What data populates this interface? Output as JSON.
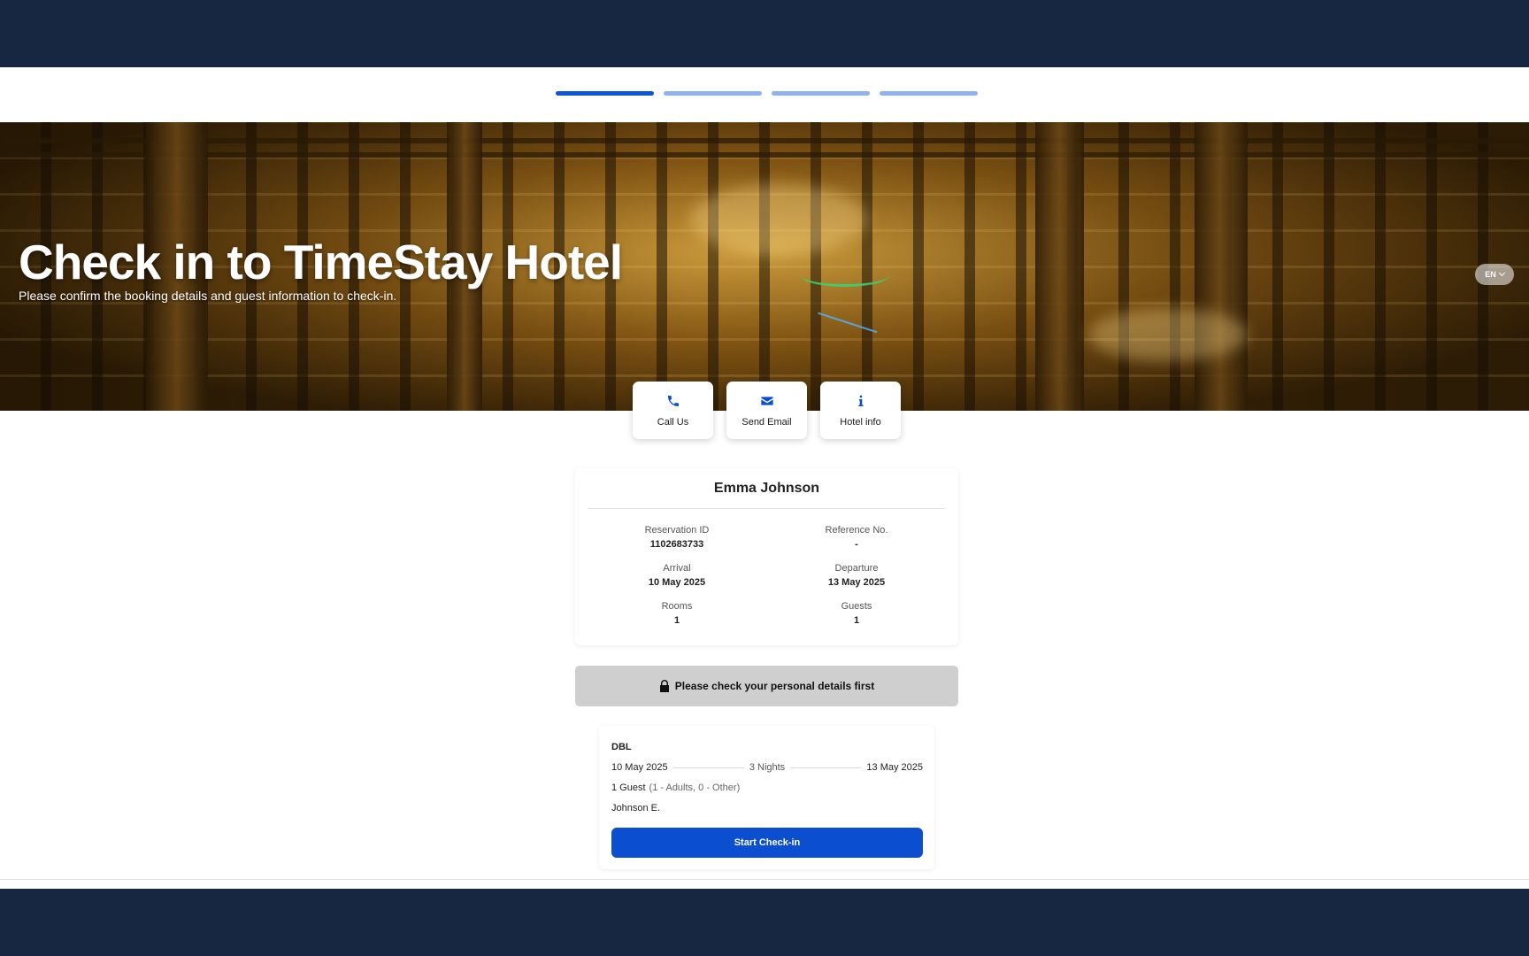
{
  "progress": {
    "steps": 4,
    "current": 1
  },
  "hero": {
    "title": "Check in to TimeStay Hotel",
    "subtitle": "Please confirm the booking details and guest information to check-in."
  },
  "language": {
    "selected": "EN"
  },
  "actions": [
    {
      "label": "Call Us",
      "icon": "phone-icon"
    },
    {
      "label": "Send Email",
      "icon": "envelope-icon"
    },
    {
      "label": "Hotel info",
      "icon": "info-icon"
    }
  ],
  "booking": {
    "guest_name": "Emma Johnson",
    "reservation_id_label": "Reservation ID",
    "reservation_id": "1102683733",
    "reference_label": "Reference No.",
    "reference": "-",
    "arrival_label": "Arrival",
    "arrival": "10 May 2025",
    "departure_label": "Departure",
    "departure": "13 May 2025",
    "rooms_label": "Rooms",
    "rooms": "1",
    "guests_label": "Guests",
    "guests": "1"
  },
  "notice": {
    "text": "Please check your personal details first",
    "icon": "lock-icon"
  },
  "room": {
    "type": "DBL",
    "arrival": "10 May 2025",
    "nights": "3 Nights",
    "departure": "13 May 2025",
    "guests": "1 Guest",
    "guests_detail": "(1 - Adults, 0 - Other)",
    "guest_name": "Johnson E.",
    "button_label": "Start Check-in"
  },
  "colors": {
    "navy": "#172641",
    "primary": "#0b4fd0",
    "progress_inactive": "#8fb3f0"
  }
}
